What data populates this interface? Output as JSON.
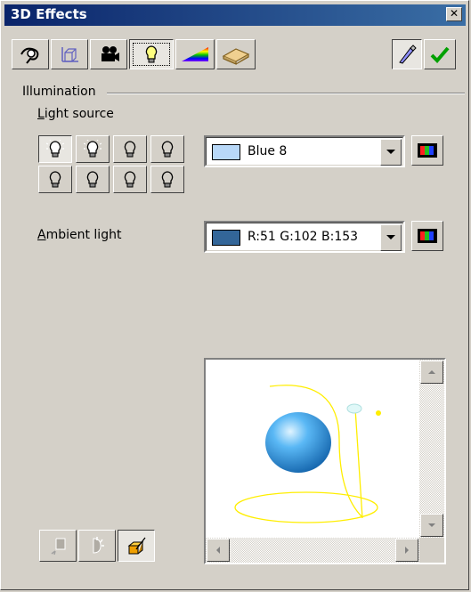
{
  "window": {
    "title": "3D Effects",
    "close_glyph": "✕"
  },
  "toolbar": {
    "buttons": [
      {
        "name": "geometry-icon",
        "pressed": false
      },
      {
        "name": "shading-icon",
        "pressed": false
      },
      {
        "name": "camera-icon",
        "pressed": false
      },
      {
        "name": "illumination-icon",
        "pressed": true
      },
      {
        "name": "textures-icon",
        "pressed": false
      },
      {
        "name": "material-icon",
        "pressed": false
      }
    ],
    "right_buttons": [
      "update-view-icon",
      "assign-checkmark-icon"
    ]
  },
  "illumination": {
    "group_label": "Illumination",
    "light_source_label": "Light source",
    "light_source_underline": "L",
    "light_source_rest": "ight source",
    "light_source_color": {
      "name": "Blue 8",
      "swatch": "#b8d8f8"
    },
    "ambient_label_underline": "A",
    "ambient_label_rest": "mbient light",
    "ambient_color": {
      "name": "R:51 G:102 B:153",
      "swatch": "#336699"
    }
  },
  "light_bulbs": [
    {
      "state": "on",
      "pressed": true
    },
    {
      "state": "on",
      "pressed": false
    },
    {
      "state": "off",
      "pressed": false
    },
    {
      "state": "off",
      "pressed": false
    },
    {
      "state": "off",
      "pressed": false
    },
    {
      "state": "off",
      "pressed": false
    },
    {
      "state": "off",
      "pressed": false
    },
    {
      "state": "off",
      "pressed": false
    }
  ],
  "preview": {
    "sphere_color": "#3a9ee8",
    "light_color": "#ffee00"
  },
  "bottom_buttons": [
    {
      "name": "convert-to-3d-icon",
      "enabled": false
    },
    {
      "name": "convert-to-rotation-object-icon",
      "enabled": false
    },
    {
      "name": "perspective-on-off-icon",
      "enabled": true,
      "pressed": true
    }
  ]
}
